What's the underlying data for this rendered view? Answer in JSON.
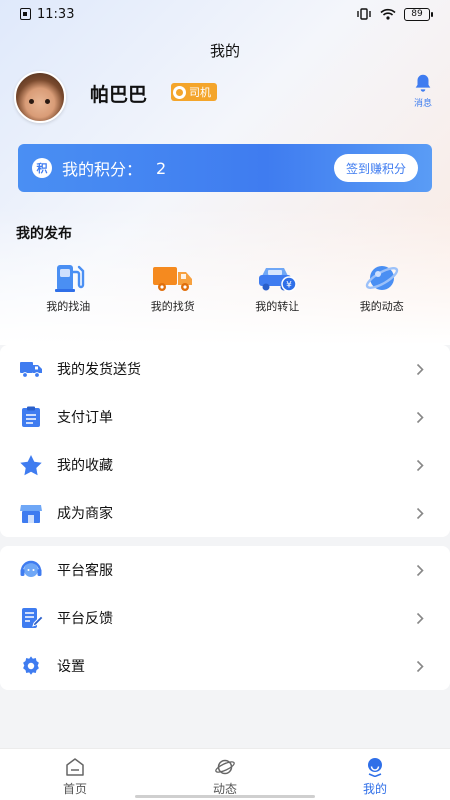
{
  "status_bar": {
    "time": "11:33",
    "battery": "89"
  },
  "header": {
    "title": "我的",
    "messages_label": "消息"
  },
  "profile": {
    "name": "帕巴巴",
    "role": "司机"
  },
  "points": {
    "label": "我的积分：",
    "value": "2",
    "button": "签到赚积分",
    "icon_text": "积"
  },
  "publish": {
    "title": "我的发布",
    "items": [
      {
        "label": "我的找油",
        "icon": "fuel-pump-icon"
      },
      {
        "label": "我的找货",
        "icon": "truck-icon"
      },
      {
        "label": "我的转让",
        "icon": "car-transfer-icon"
      },
      {
        "label": "我的动态",
        "icon": "planet-icon"
      }
    ]
  },
  "menu1": [
    {
      "label": "我的发货送货",
      "icon": "delivery-truck-icon"
    },
    {
      "label": "支付订单",
      "icon": "order-list-icon"
    },
    {
      "label": "我的收藏",
      "icon": "star-icon"
    },
    {
      "label": "成为商家",
      "icon": "store-icon"
    }
  ],
  "menu2": [
    {
      "label": "平台客服",
      "icon": "customer-service-icon"
    },
    {
      "label": "平台反馈",
      "icon": "feedback-icon"
    },
    {
      "label": "设置",
      "icon": "settings-gear-icon"
    }
  ],
  "tabbar": [
    {
      "label": "首页",
      "icon": "home-icon"
    },
    {
      "label": "动态",
      "icon": "planet-icon"
    },
    {
      "label": "我的",
      "icon": "profile-icon",
      "active": true
    }
  ],
  "colors": {
    "accent": "#3f7cf0",
    "badge": "#f4a52b",
    "truck": "#f58a1f"
  }
}
